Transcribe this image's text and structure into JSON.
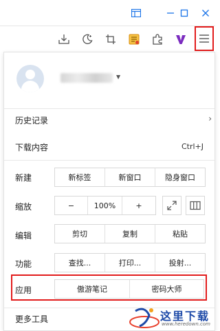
{
  "toolbar": {
    "icons": [
      "download-icon",
      "night-mode-icon",
      "crop-icon",
      "notes-icon",
      "extensions-icon",
      "v-icon",
      "menu-icon"
    ]
  },
  "menu": {
    "history": "历史记录",
    "downloads": "下载内容",
    "downloads_shortcut": "Ctrl+J",
    "new_label": "新建",
    "new_tab": "新标签",
    "new_window": "新窗口",
    "incognito_window": "隐身窗口",
    "zoom_label": "缩放",
    "zoom_out": "−",
    "zoom_value": "100%",
    "zoom_in": "+",
    "edit_label": "编辑",
    "cut": "剪切",
    "copy": "复制",
    "paste": "粘贴",
    "function_label": "功能",
    "find": "查找...",
    "print": "打印...",
    "cast": "投射...",
    "apps_label": "应用",
    "maxthon_notes": "傲游笔记",
    "password_master": "密码大师",
    "more_tools": "更多工具"
  },
  "watermark": {
    "text": "这里下载",
    "url": "www.heredown.com"
  },
  "colors": {
    "accent": "#1a73e8",
    "highlight": "#e21b1b",
    "notes_icon": "#e8a317",
    "v_icon": "#7b2cbf"
  }
}
